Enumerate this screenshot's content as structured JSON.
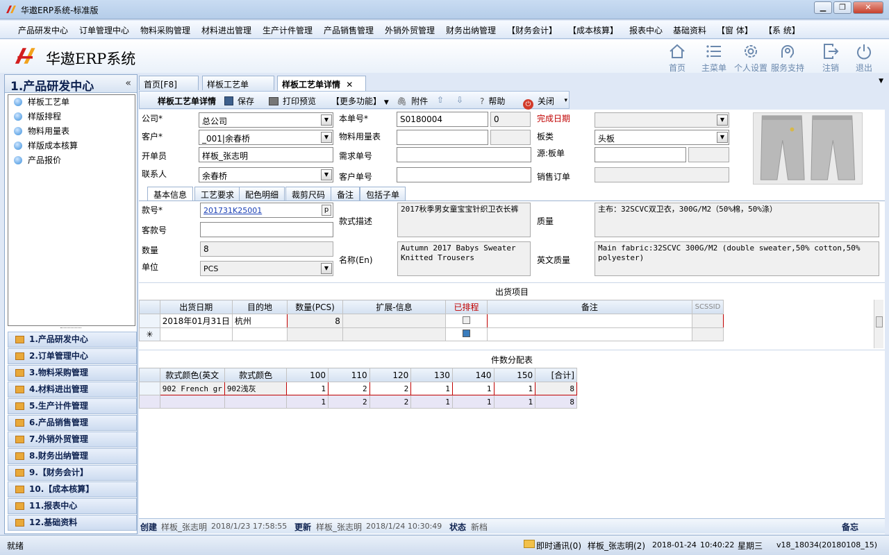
{
  "window": {
    "title": "华遨ERP系统-标准版"
  },
  "menu": [
    "产品研发中心",
    "订单管理中心",
    "物料采购管理",
    "材料进出管理",
    "生产计件管理",
    "产品销售管理",
    "外销外贸管理",
    "财务出纳管理",
    "【财务会计】",
    "【成本核算】",
    "报表中心",
    "基础资料",
    "【窗 体】",
    "【系 统】"
  ],
  "brand": {
    "name": "华遨ERP系统"
  },
  "header_buttons": [
    "首页",
    "主菜单",
    "个人设置",
    "服务支持",
    "注销",
    "退出"
  ],
  "left": {
    "section_title": "1.产品研发中心",
    "collapse_glyph": "«",
    "tree": [
      "样板工艺单",
      "样版排程",
      "物料用量表",
      "样版成本核算",
      "产品报价"
    ],
    "nav": [
      "1.产品研发中心",
      "2.订单管理中心",
      "3.物料采购管理",
      "4.材料进出管理",
      "5.生产计件管理",
      "6.产品销售管理",
      "7.外销外贸管理",
      "8.财务出纳管理",
      "9.【财务会计】",
      "10.【成本核算】",
      "11.报表中心",
      "12.基础资料"
    ]
  },
  "tabs": {
    "home": "首页[F8]",
    "list": "样板工艺单",
    "detail": "样板工艺单详情",
    "close": "✕"
  },
  "toolbar": {
    "title": "样板工艺单详情",
    "save": "保存",
    "print": "打印预览",
    "more": "【更多功能】",
    "attach": "附件",
    "help": "帮助",
    "close": "关闭"
  },
  "form": {
    "company_label": "公司*",
    "company": "总公司",
    "customer_label": "客户*",
    "customer": "_001|余春桥",
    "creator_label": "开单员",
    "creator": "样板_张志明",
    "contact_label": "联系人",
    "contact": "余春桥",
    "doc_no_label": "本单号*",
    "doc_no": "S0180004",
    "doc_no_extra": "0",
    "material_label": "物料用量表",
    "demand_label": "需求单号",
    "cust_no_label": "客户单号",
    "finish_label": "完成日期",
    "board_label": "板类",
    "board": "头板",
    "source_label": "源:板单",
    "sales_label": "销售订单"
  },
  "subtabs": [
    "基本信息",
    "工艺要求",
    "配色明细",
    "裁剪尺码",
    "备注",
    "包括子单"
  ],
  "basic": {
    "style_no_label": "款号*",
    "style_no": "201731K25001",
    "style_btn": "p",
    "cust_style_label": "客款号",
    "qty_label": "数量",
    "qty": "8",
    "unit_label": "单位",
    "unit": "PCS",
    "desc_label": "款式描述",
    "desc": "2017秋季男女童宝宝针织卫衣长裤",
    "name_en_label": "名称(En)",
    "name_en": "Autumn 2017 Babys Sweater Knitted Trousers",
    "quality_label": "质量",
    "quality": "主布：32SCVC双卫衣，300G/M2（50%棉，50%涤）",
    "quality_en_label": "英文质量",
    "quality_en": "Main fabric:32SCVC 300G/M2 (double sweater,50% cotton,50% polyester)"
  },
  "shipping": {
    "title": "出货项目",
    "columns": [
      "出货日期",
      "目的地",
      "数量(PCS)",
      "扩展-信息",
      "已排程",
      "备注",
      "SCSSID"
    ],
    "rows": [
      {
        "date": "2018年01月31日",
        "dest": "杭州",
        "qty": "8"
      }
    ],
    "new_row_marker": "✳"
  },
  "sizes": {
    "title": "件数分配表",
    "columns": [
      "款式颜色(英文",
      "款式颜色",
      "100",
      "110",
      "120",
      "130",
      "140",
      "150",
      "[合计]"
    ],
    "row": [
      "902 French gr",
      "902浅灰",
      "1",
      "2",
      "2",
      "1",
      "1",
      "1",
      "8"
    ],
    "total": [
      "1",
      "2",
      "2",
      "1",
      "1",
      "1",
      "8"
    ]
  },
  "record": {
    "created_label": "创建",
    "created_by": "样板_张志明",
    "created_at": "2018/1/23 17:58:55",
    "updated_label": "更新",
    "updated_by": "样板_张志明",
    "updated_at": "2018/1/24 10:30:49",
    "state_label": "状态",
    "state": "新档",
    "memo": "备忘"
  },
  "status": {
    "ready": "就绪",
    "im": "即时通讯(0)",
    "user": "样板_张志明(2)",
    "date": "2018-01-24",
    "time": "10:40:22",
    "weekday": "星期三",
    "version": "v18_18034(20180108_15)"
  },
  "colors": {
    "accent": "#0e2250",
    "red": "#c00000",
    "header_icon": "#6a88ad"
  }
}
